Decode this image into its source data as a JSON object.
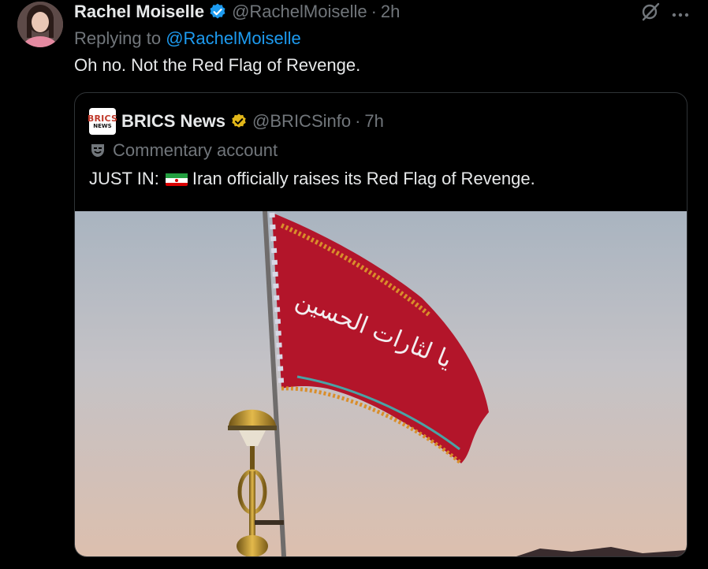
{
  "reply": {
    "author_name": "Rachel Moiselle",
    "author_handle": "@RachelMoiselle",
    "separator": "·",
    "time": "2h",
    "replying_prefix": "Replying to",
    "replying_to": "@RachelMoiselle",
    "text": "Oh no. Not the Red Flag of Revenge."
  },
  "quoted": {
    "logo_top": "BRICS",
    "logo_bottom": "NEWS",
    "author_name": "BRICS News",
    "author_handle": "@BRICSinfo",
    "separator": "·",
    "time": "7h",
    "account_label": "Commentary account",
    "text_prefix": "JUST IN:",
    "text_body": "Iran officially raises its Red Flag of Revenge.",
    "flag_inscription": "يا لثارات الحسين"
  },
  "icons": {
    "verified": "verified-badge-icon",
    "gold_verified": "gold-verified-badge-icon",
    "grok": "grok-icon",
    "more": "more-icon",
    "commentary": "theater-mask-icon"
  },
  "colors": {
    "background": "#000000",
    "text": "#e7e9ea",
    "muted": "#71767b",
    "link": "#1d9bf0",
    "border": "#2f3336",
    "flag_red": "#b3152a",
    "gold_badge": "#e2b719"
  }
}
